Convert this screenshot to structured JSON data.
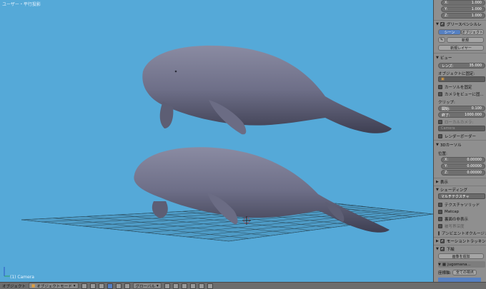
{
  "viewport": {
    "title": "ユーザー・平行投影",
    "camera_label": "(1) Camera"
  },
  "sidebar": {
    "location": {
      "x_label": "X:",
      "x_value": "1.000",
      "y_label": "Y:",
      "y_value": "1.000",
      "z_label": "Z:",
      "z_value": "1.000"
    },
    "grease_pencil": {
      "header": "グリースペンシルレ",
      "scene_button": "シーン",
      "object_button": "オブジェクト",
      "new_button": "新規",
      "new_layer_button": "新規レイヤー"
    },
    "view": {
      "header": "ビュー",
      "lens_label": "レンズ:",
      "lens_value": "35.000",
      "lock_to_object": "オブジェクトに固定:",
      "lock_cursor": "カーソルを固定",
      "lock_camera": "カメラをビューに固...",
      "clip_label": "クリップ:",
      "clip_start_label": "開始:",
      "clip_start_value": "0.100",
      "clip_end_label": "終了:",
      "clip_end_value": "1000.000",
      "local_camera": "ローカルカメラ:",
      "camera_field": "Camera",
      "render_border": "レンダーボーダー"
    },
    "cursor": {
      "header": "3Dカーソル",
      "location_label": "位置:",
      "x_label": "X:",
      "x_value": "0.00000",
      "y_label": "Y:",
      "y_value": "0.00000",
      "z_label": "Z:",
      "z_value": "0.00000"
    },
    "display": {
      "header": "表示"
    },
    "shading": {
      "header": "シェーディング",
      "mode_value": "マルチテクスチャ",
      "textured_solid": "テクスチャソリッド",
      "matcap": "Matcap",
      "backface_culling": "裏面の非表示",
      "depth_of_field": "被写界深度",
      "ambient_occlusion": "アンビエントオクルージョン"
    },
    "motion_tracking": {
      "header": "モーショントラッキング"
    },
    "background_images": {
      "header": "下絵",
      "add_image_button": "画像を追加",
      "image_name": "jugomana...",
      "axis_label": "座標軸:",
      "axis_value": "全ての視点"
    }
  },
  "toolbar": {
    "object_menu": "オブジェクト",
    "mode": "オブジェクトモード",
    "orientation": "グローバル"
  },
  "colors": {
    "viewport_bg": "#55a9d8",
    "panel_bg": "#8f8f8f",
    "accent": "#5680c2",
    "grid": "#2a4a5a",
    "body_color": "#6e6f86"
  }
}
